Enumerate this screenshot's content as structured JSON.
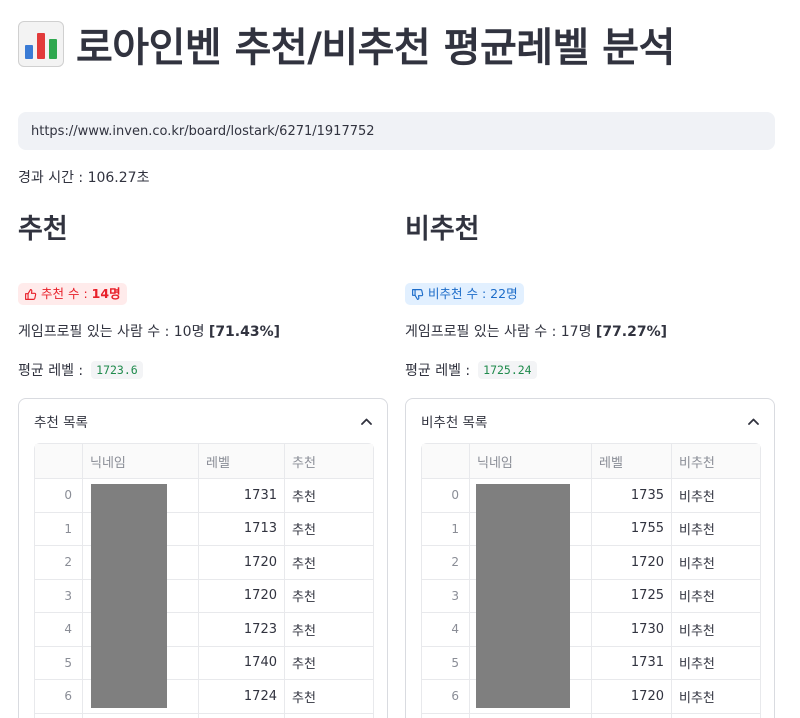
{
  "page": {
    "title": "로아인벤 추천/비추천 평균레벨 분석",
    "icon": "bar-chart-icon",
    "colors": {
      "accent_red": "#e8202a",
      "accent_blue": "#1c6cc9",
      "code_green": "#1f8a4c",
      "input_bg": "#f0f2f6",
      "redaction": "#7f7f7f"
    }
  },
  "url_input": {
    "value": "https://www.inven.co.kr/board/lostark/6271/1917752"
  },
  "elapsed": {
    "text": "경과 시간 : 106.27초"
  },
  "recommend": {
    "title": "추천",
    "badge_icon": "thumbs-up-icon",
    "badge_label": "추천 수 : ",
    "badge_count": "14명",
    "profile_text": "게임프로필 있는 사람 수 : 10명 ",
    "profile_pct": "[71.43%]",
    "avg_label": "평균 레벨 :",
    "avg_value": "1723.6",
    "list_title": "추천 목록",
    "columns": [
      "",
      "닉네임",
      "레벨",
      "추천"
    ],
    "rows": [
      {
        "idx": "0",
        "level": "1731",
        "type": "추천"
      },
      {
        "idx": "1",
        "level": "1713",
        "type": "추천"
      },
      {
        "idx": "2",
        "level": "1720",
        "type": "추천"
      },
      {
        "idx": "3",
        "level": "1720",
        "type": "추천"
      },
      {
        "idx": "4",
        "level": "1723",
        "type": "추천"
      },
      {
        "idx": "5",
        "level": "1740",
        "type": "추천"
      },
      {
        "idx": "6",
        "level": "1724",
        "type": "추천"
      }
    ]
  },
  "not_recommend": {
    "title": "비추천",
    "badge_icon": "thumbs-down-icon",
    "badge_label": "비추천 수 : ",
    "badge_count": "22명",
    "profile_text": "게임프로필 있는 사람 수 : 17명 ",
    "profile_pct": "[77.27%]",
    "avg_label": "평균 레벨 :",
    "avg_value": "1725.24",
    "list_title": "비추천 목록",
    "columns": [
      "",
      "닉네임",
      "레벨",
      "비추천"
    ],
    "rows": [
      {
        "idx": "0",
        "level": "1735",
        "type": "비추천"
      },
      {
        "idx": "1",
        "level": "1755",
        "type": "비추천"
      },
      {
        "idx": "2",
        "level": "1720",
        "type": "비추천"
      },
      {
        "idx": "3",
        "level": "1725",
        "type": "비추천"
      },
      {
        "idx": "4",
        "level": "1730",
        "type": "비추천"
      },
      {
        "idx": "5",
        "level": "1731",
        "type": "비추천"
      },
      {
        "idx": "6",
        "level": "1720",
        "type": "비추천"
      }
    ]
  }
}
